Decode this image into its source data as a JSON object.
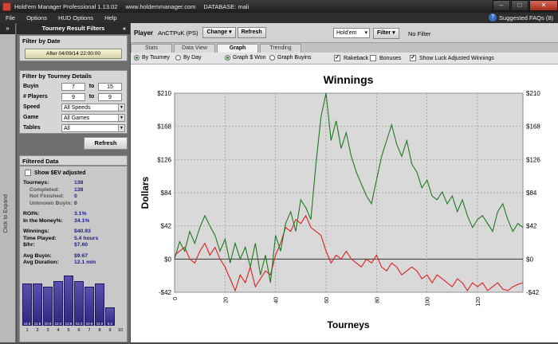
{
  "titlebar": {
    "app_title": "Hold'em Manager Professional 1.13.02",
    "site": "www.holdemmanager.com",
    "database": "DATABASE: mali"
  },
  "menu": {
    "items": [
      "File",
      "Options",
      "HUD Options",
      "Help"
    ],
    "faq": "Suggested FAQs (8)"
  },
  "expand_label": "Click to Expand",
  "panel": {
    "title": "Tourney Result Filters",
    "filter_by_date": "Filter by Date",
    "date_button": "After 04/09/14 22:00:00",
    "filter_by_details": "Filter by Tourney Details",
    "buyin_label": "Buyin",
    "buyin_from": "7",
    "buyin_to": "15",
    "players_label": "# Players",
    "players_from": "9",
    "players_to": "9",
    "to_label": "to",
    "speed_label": "Speed",
    "speed_value": "All Speeds",
    "game_label": "Game",
    "game_value": "All Games",
    "tables_label": "Tables",
    "tables_value": "All",
    "refresh": "Refresh"
  },
  "filtered": {
    "title": "Filtered Data",
    "show_ev": "Show $EV adjusted",
    "tourneys_label": "Tourneys:",
    "tourneys": "138",
    "completed_label": "Completed:",
    "completed": "138",
    "not_finished_label": "Not Finished:",
    "not_finished": "0",
    "unknown_label": "Unknown Buyin:",
    "unknown": "0",
    "roi_label": "ROI%:",
    "roi": "3.1%",
    "itm_label": "In the Money%:",
    "itm": "34.1%",
    "winnings_label": "Winnings:",
    "winnings": "$40.93",
    "time_label": "Time Played:",
    "time": "5.4 hours",
    "hr_label": "$/hr:",
    "hr": "$7.60",
    "avgbuyin_label": "Avg Buyin:",
    "avgbuyin": "$9.67",
    "avgdur_label": "Avg Duration:",
    "avgdur": "12.1 min",
    "bars": [
      {
        "pos": "1",
        "pct": "11.6",
        "value": 11.6
      },
      {
        "pos": "2",
        "pct": "11.6",
        "value": 11.6
      },
      {
        "pos": "3",
        "pct": "10.9",
        "value": 10.9
      },
      {
        "pos": "4",
        "pct": "12.3",
        "value": 12.3
      },
      {
        "pos": "5",
        "pct": "13.8",
        "value": 13.8
      },
      {
        "pos": "6",
        "pct": "12.3",
        "value": 12.3
      },
      {
        "pos": "7",
        "pct": "10.9",
        "value": 10.9
      },
      {
        "pos": "8",
        "pct": "11.6",
        "value": 11.6
      },
      {
        "pos": "9",
        "pct": "5.1",
        "value": 5.1
      },
      {
        "pos": "10",
        "pct": "",
        "value": 0
      }
    ]
  },
  "playerbar": {
    "label": "Player",
    "name": "AnCTPuK (PS)",
    "change": "Change",
    "refresh": "Refresh",
    "game": "Hold'em",
    "filter": "Filter",
    "no_filter": "No Filter"
  },
  "tabs": [
    "Stats",
    "Data View",
    "Graph",
    "Trending"
  ],
  "options": {
    "by_tourney": "By Tourney",
    "by_day": "By Day",
    "graph_won": "Graph $ Won",
    "graph_buyins": "Graph Buyins",
    "rakeback": "Rakeback",
    "bonuses": "Bonuses",
    "luck": "Show Luck Adjusted Winnings"
  },
  "colors": {
    "won": "#1f7a1f",
    "luck": "#e02020",
    "bar": "#3a3090"
  },
  "chart_data": {
    "type": "line",
    "title": "Winnings",
    "xlabel": "Tourneys",
    "ylabel": "Dollars",
    "xlim": [
      0,
      138
    ],
    "ylim": [
      -42,
      210
    ],
    "yticks": [
      -42,
      0,
      42,
      84,
      126,
      168,
      210
    ],
    "ytick_labels": [
      "-$42",
      "$0",
      "$42",
      "$84",
      "$126",
      "$168",
      "$210"
    ],
    "xticks": [
      0,
      20,
      40,
      60,
      80,
      100,
      120
    ],
    "grid": true,
    "series": [
      {
        "name": "Graph $ Won",
        "color": "#1f7a1f",
        "x": [
          0,
          2,
          4,
          6,
          8,
          10,
          12,
          14,
          16,
          18,
          20,
          22,
          24,
          26,
          28,
          30,
          32,
          34,
          36,
          38,
          40,
          42,
          44,
          46,
          48,
          50,
          52,
          54,
          56,
          58,
          60,
          62,
          64,
          66,
          68,
          70,
          72,
          74,
          76,
          78,
          80,
          82,
          84,
          86,
          88,
          90,
          92,
          94,
          96,
          98,
          100,
          102,
          104,
          106,
          108,
          110,
          112,
          114,
          116,
          118,
          120,
          122,
          124,
          126,
          128,
          130,
          132,
          134,
          136,
          138
        ],
        "y": [
          0,
          22,
          10,
          35,
          20,
          40,
          55,
          42,
          30,
          10,
          25,
          -5,
          20,
          0,
          15,
          -10,
          20,
          -20,
          5,
          -30,
          30,
          10,
          45,
          60,
          35,
          75,
          65,
          50,
          120,
          180,
          210,
          150,
          175,
          140,
          160,
          130,
          110,
          95,
          80,
          70,
          100,
          130,
          150,
          170,
          145,
          130,
          150,
          120,
          110,
          90,
          100,
          80,
          75,
          85,
          70,
          80,
          60,
          75,
          55,
          40,
          50,
          55,
          45,
          35,
          60,
          70,
          50,
          35,
          45,
          40
        ]
      },
      {
        "name": "Luck Adjusted",
        "color": "#e02020",
        "x": [
          0,
          2,
          4,
          6,
          8,
          10,
          12,
          14,
          16,
          18,
          20,
          22,
          24,
          26,
          28,
          30,
          32,
          34,
          36,
          38,
          40,
          42,
          44,
          46,
          48,
          50,
          52,
          54,
          56,
          58,
          60,
          62,
          64,
          66,
          68,
          70,
          72,
          74,
          76,
          78,
          80,
          82,
          84,
          86,
          88,
          90,
          92,
          94,
          96,
          98,
          100,
          102,
          104,
          106,
          108,
          110,
          112,
          114,
          116,
          118,
          120,
          122,
          124,
          126,
          128,
          130,
          132,
          134,
          136,
          138
        ],
        "y": [
          5,
          10,
          15,
          0,
          -5,
          10,
          20,
          5,
          15,
          0,
          -10,
          -25,
          -40,
          -20,
          -30,
          -10,
          -35,
          -25,
          -15,
          -20,
          5,
          20,
          40,
          35,
          50,
          45,
          55,
          40,
          35,
          30,
          10,
          -5,
          5,
          0,
          10,
          0,
          -5,
          -10,
          0,
          -5,
          5,
          -10,
          -15,
          -5,
          -10,
          -20,
          -15,
          -10,
          -15,
          -25,
          -20,
          -30,
          -20,
          -25,
          -30,
          -35,
          -25,
          -30,
          -40,
          -30,
          -35,
          -30,
          -40,
          -35,
          -30,
          -38,
          -40,
          -35,
          -32,
          -30
        ]
      }
    ]
  }
}
